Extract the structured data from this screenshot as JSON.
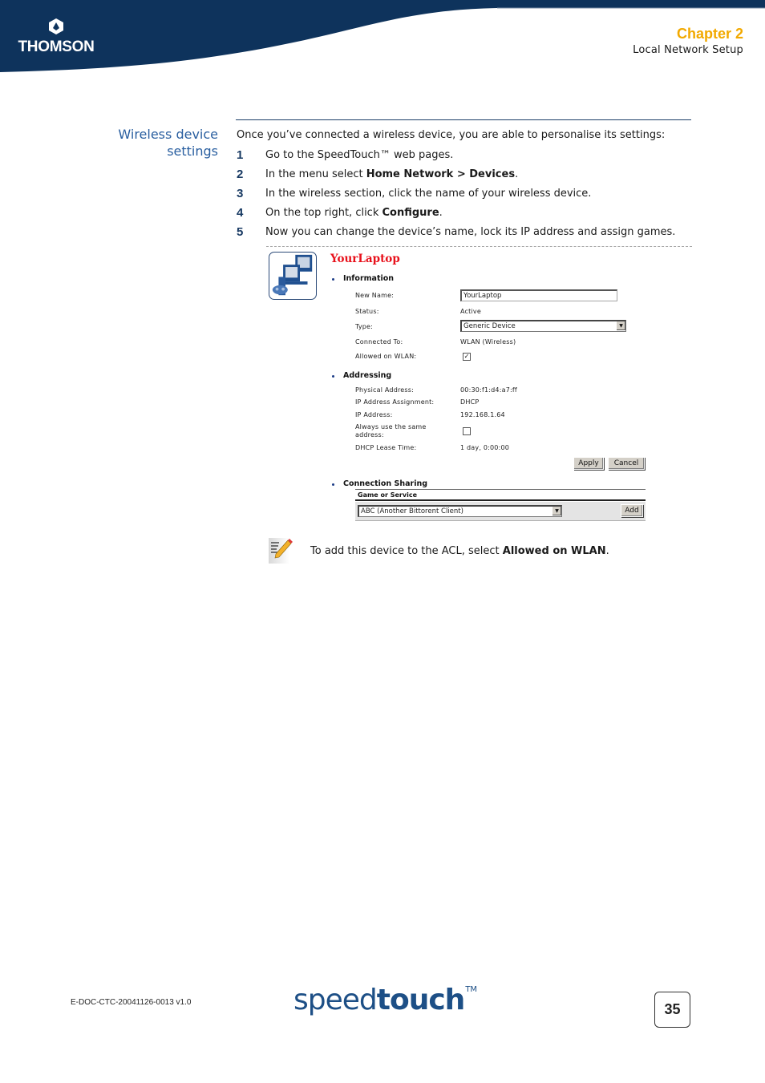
{
  "header": {
    "logo_text": "THOMSON",
    "chapter_label": "Chapter 2",
    "chapter_title": "Local Network Setup",
    "brand_color": "#0e335c",
    "accent_color": "#f2a900"
  },
  "section": {
    "title_line1": "Wireless device",
    "title_line2": "settings",
    "intro": "Once you’ve connected a wireless device, you are able to personalise its settings:",
    "steps": [
      {
        "num": "1",
        "pre": "Go to the SpeedTouch™ web pages.",
        "bold": "",
        "post": ""
      },
      {
        "num": "2",
        "pre": "In the menu select ",
        "bold": "Home Network > Devices",
        "post": "."
      },
      {
        "num": "3",
        "pre": "In the wireless section, click the name of your wireless device.",
        "bold": "",
        "post": ""
      },
      {
        "num": "4",
        "pre": "On the top right, click ",
        "bold": "Configure",
        "post": "."
      },
      {
        "num": "5",
        "pre": "Now you can change the device’s name, lock its IP address and assign games.",
        "bold": "",
        "post": ""
      }
    ]
  },
  "device_panel": {
    "title": "YourLaptop",
    "icon": "devices-icon",
    "information": {
      "heading": "Information",
      "new_name_label": "New Name:",
      "new_name_value": "YourLaptop",
      "status_label": "Status:",
      "status_value": "Active",
      "type_label": "Type:",
      "type_value": "Generic Device",
      "connected_label": "Connected To:",
      "connected_value": "WLAN (Wireless)",
      "allowed_label": "Allowed on WLAN:",
      "allowed_checked": true
    },
    "addressing": {
      "heading": "Addressing",
      "physical_label": "Physical Address:",
      "physical_value": "00:30:f1:d4:a7:ff",
      "assignment_label": "IP Address Assignment:",
      "assignment_value": "DHCP",
      "ip_label": "IP Address:",
      "ip_value": "192.168.1.64",
      "same_label_1": "Always use the same",
      "same_label_2": "address:",
      "same_checked": false,
      "lease_label": "DHCP Lease Time:",
      "lease_value": "1 day, 0:00:00"
    },
    "buttons": {
      "apply": "Apply",
      "cancel": "Cancel"
    },
    "connection_sharing": {
      "heading": "Connection Sharing",
      "column_header": "Game or Service",
      "selected_game": "ABC (Another Bittorent Client)",
      "add_button": "Add"
    }
  },
  "note": {
    "pre": "To add this device to the ACL, select ",
    "bold": "Allowed on WLAN",
    "post": "."
  },
  "footer": {
    "doc_id": "E-DOC-CTC-20041126-0013 v1.0",
    "brand_light": "speed",
    "brand_bold": "touch",
    "brand_tm": "TM",
    "page_number": "35"
  }
}
